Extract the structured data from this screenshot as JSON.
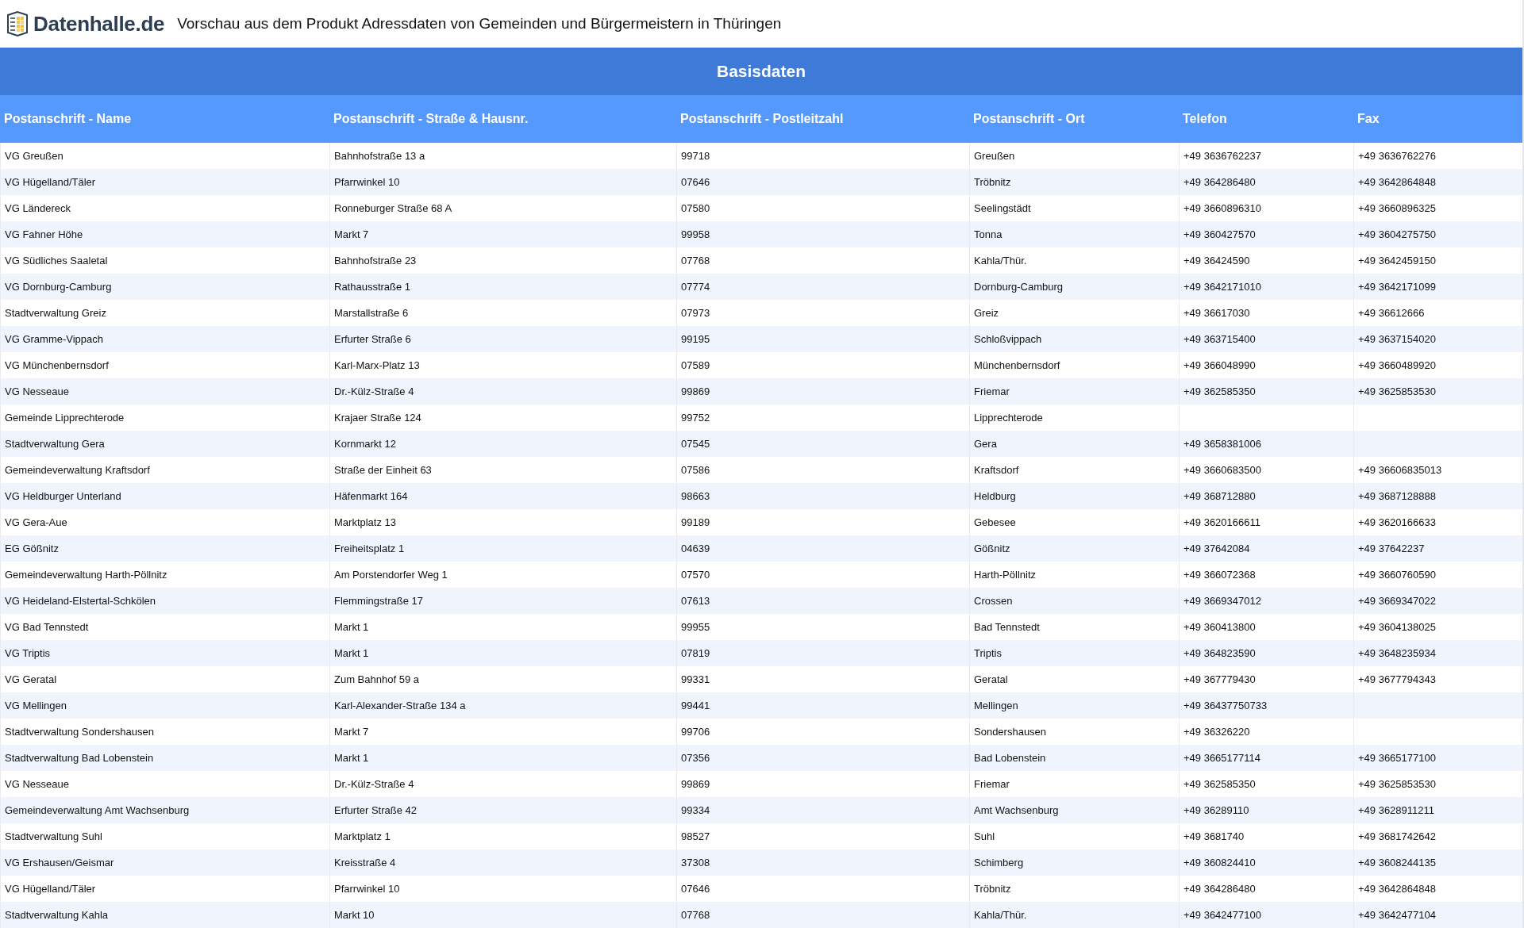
{
  "header": {
    "logo": "Datenhalle.de",
    "title": "Vorschau aus dem Produkt Adressdaten von Gemeinden und Bürgermeistern in Thüringen"
  },
  "table": {
    "caption": "Basisdaten",
    "columns": [
      "Postanschrift - Name",
      "Postanschrift - Straße & Hausnr.",
      "Postanschrift - Postleitzahl",
      "Postanschrift - Ort",
      "Telefon",
      "Fax"
    ],
    "rows": [
      [
        "VG Greußen",
        "Bahnhofstraße 13 a",
        "99718",
        "Greußen",
        "+49 3636762237",
        "+49 3636762276"
      ],
      [
        "VG Hügelland/Täler",
        "Pfarrwinkel 10",
        "07646",
        "Tröbnitz",
        "+49 364286480",
        "+49 3642864848"
      ],
      [
        "VG Ländereck",
        "Ronneburger Straße 68 A",
        "07580",
        "Seelingstädt",
        "+49 3660896310",
        "+49 3660896325"
      ],
      [
        "VG Fahner Höhe",
        "Markt 7",
        "99958",
        "Tonna",
        "+49 360427570",
        "+49 3604275750"
      ],
      [
        "VG Südliches Saaletal",
        "Bahnhofstraße 23",
        "07768",
        "Kahla/Thür.",
        "+49 36424590",
        "+49 3642459150"
      ],
      [
        "VG Dornburg-Camburg",
        "Rathausstraße 1",
        "07774",
        "Dornburg-Camburg",
        "+49 3642171010",
        "+49 3642171099"
      ],
      [
        "Stadtverwaltung Greiz",
        "Marstallstraße 6",
        "07973",
        "Greiz",
        "+49 36617030",
        "+49 36612666"
      ],
      [
        "VG Gramme-Vippach",
        "Erfurter Straße 6",
        "99195",
        "Schloßvippach",
        "+49 363715400",
        "+49 3637154020"
      ],
      [
        "VG Münchenbernsdorf",
        "Karl-Marx-Platz 13",
        "07589",
        "Münchenbernsdorf",
        "+49 366048990",
        "+49 3660489920"
      ],
      [
        "VG Nesseaue",
        "Dr.-Külz-Straße 4",
        "99869",
        "Friemar",
        "+49 362585350",
        "+49 3625853530"
      ],
      [
        "Gemeinde Lipprechterode",
        "Krajaer Straße 124",
        "99752",
        "Lipprechterode",
        null,
        null
      ],
      [
        "Stadtverwaltung Gera",
        "Kornmarkt 12",
        "07545",
        "Gera",
        "+49 3658381006",
        null
      ],
      [
        "Gemeindeverwaltung Kraftsdorf",
        "Straße der Einheit 63",
        "07586",
        "Kraftsdorf",
        "+49 3660683500",
        "+49 36606835013"
      ],
      [
        "VG Heldburger Unterland",
        "Häfenmarkt 164",
        "98663",
        "Heldburg",
        "+49 368712880",
        "+49 3687128888"
      ],
      [
        "VG Gera-Aue",
        "Marktplatz 13",
        "99189",
        "Gebesee",
        "+49 3620166611",
        "+49 3620166633"
      ],
      [
        "EG Gößnitz",
        "Freiheitsplatz 1",
        "04639",
        "Gößnitz",
        "+49 37642084",
        "+49 37642237"
      ],
      [
        "Gemeindeverwaltung Harth-Pöllnitz",
        "Am Porstendorfer Weg 1",
        "07570",
        "Harth-Pöllnitz",
        "+49 366072368",
        "+49 3660760590"
      ],
      [
        "VG Heideland-Elstertal-Schkölen",
        "Flemmingstraße 17",
        "07613",
        "Crossen",
        "+49 3669347012",
        "+49 3669347022"
      ],
      [
        "VG Bad Tennstedt",
        "Markt 1",
        "99955",
        "Bad Tennstedt",
        "+49 360413800",
        "+49 3604138025"
      ],
      [
        "VG Triptis",
        "Markt 1",
        "07819",
        "Triptis",
        "+49 364823590",
        "+49 3648235934"
      ],
      [
        "VG Geratal",
        "Zum Bahnhof 59 a",
        "99331",
        "Geratal",
        "+49 367779430",
        "+49 3677794343"
      ],
      [
        "VG Mellingen",
        "Karl-Alexander-Straße 134 a",
        "99441",
        "Mellingen",
        "+49 36437750733",
        null
      ],
      [
        "Stadtverwaltung Sondershausen",
        "Markt 7",
        "99706",
        "Sondershausen",
        "+49 36326220",
        null
      ],
      [
        "Stadtverwaltung Bad Lobenstein",
        "Markt 1",
        "07356",
        "Bad Lobenstein",
        "+49 3665177114",
        "+49 3665177100"
      ],
      [
        "VG Nesseaue",
        "Dr.-Külz-Straße 4",
        "99869",
        "Friemar",
        "+49 362585350",
        "+49 3625853530"
      ],
      [
        "Gemeindeverwaltung Amt Wachsenburg",
        "Erfurter Straße 42",
        "99334",
        "Amt Wachsenburg",
        "+49 36289110",
        "+49 3628911211"
      ],
      [
        "Stadtverwaltung Suhl",
        "Marktplatz 1",
        "98527",
        "Suhl",
        "+49 3681740",
        "+49 3681742642"
      ],
      [
        "VG Ershausen/Geismar",
        "Kreisstraße 4",
        "37308",
        "Schimberg",
        "+49 360824410",
        "+49 3608244135"
      ],
      [
        "VG Hügelland/Täler",
        "Pfarrwinkel 10",
        "07646",
        "Tröbnitz",
        "+49 364286480",
        "+49 3642864848"
      ],
      [
        "Stadtverwaltung Kahla",
        "Markt 10",
        "07768",
        "Kahla/Thür.",
        "+49 3642477100",
        "+49 3642477104"
      ]
    ]
  }
}
